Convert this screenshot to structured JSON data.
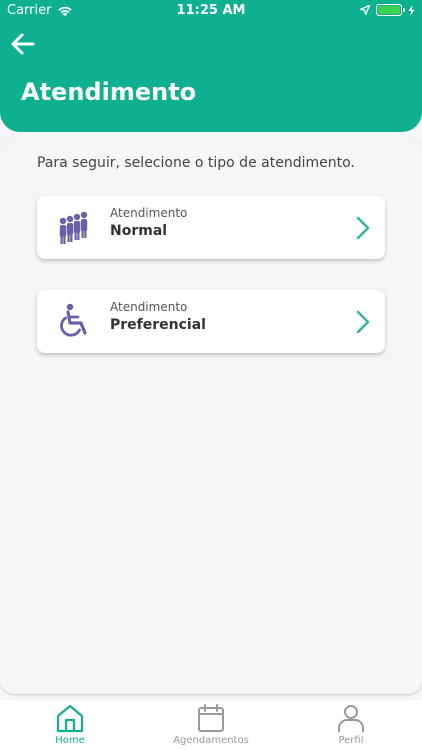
{
  "status_bar": {
    "carrier": "Carrier",
    "time": "11:25 AM"
  },
  "header": {
    "title": "Atendimento",
    "back_icon": "arrow-left-icon"
  },
  "instruction": "Para seguir, selecione o tipo de atendimento.",
  "options": [
    {
      "subtitle": "Atendimento",
      "label": "Normal",
      "icon": "people-queue-icon"
    },
    {
      "subtitle": "Atendimento",
      "label": "Preferencial",
      "icon": "wheelchair-icon"
    }
  ],
  "tabbar": {
    "items": [
      {
        "label": "Home",
        "icon": "home-icon",
        "active": true
      },
      {
        "label": "Agendamentos",
        "icon": "calendar-icon",
        "active": false
      },
      {
        "label": "Perfil",
        "icon": "person-icon",
        "active": false
      }
    ]
  },
  "colors": {
    "brand": "#0fb08f",
    "icon_purple": "#6c5fa8",
    "chevron": "#35b6a0"
  }
}
